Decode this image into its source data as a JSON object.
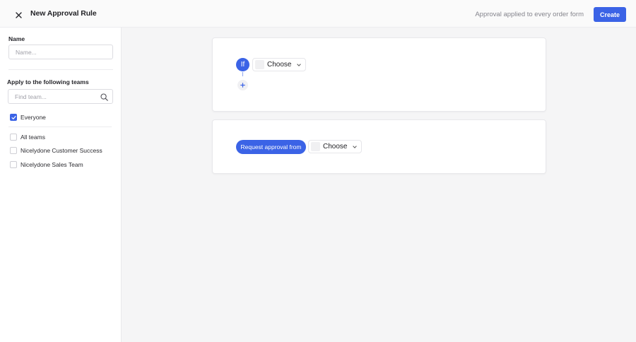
{
  "header": {
    "title": "New Approval Rule",
    "status": "Approval applied to every order form",
    "create_label": "Create"
  },
  "sidebar": {
    "name_label": "Name",
    "name_placeholder": "Name...",
    "name_value": "",
    "teams_label": "Apply to the following teams",
    "team_search_placeholder": "Find team...",
    "everyone": {
      "label": "Everyone",
      "checked": true
    },
    "teams": [
      {
        "label": "All teams",
        "checked": false
      },
      {
        "label": "Nicelydone Customer Success",
        "checked": false
      },
      {
        "label": "Nicelydone Sales Team",
        "checked": false
      }
    ]
  },
  "rule": {
    "condition": {
      "if_label": "If",
      "choose_label": "Choose"
    },
    "approval": {
      "request_label": "Request approval from",
      "choose_label": "Choose"
    }
  },
  "colors": {
    "accent": "#3b63e6",
    "background": "#f5f5f6",
    "panel": "#ffffff"
  },
  "icons": [
    "close-icon",
    "search-icon",
    "check-icon",
    "plus-icon",
    "chevron-down-icon"
  ]
}
